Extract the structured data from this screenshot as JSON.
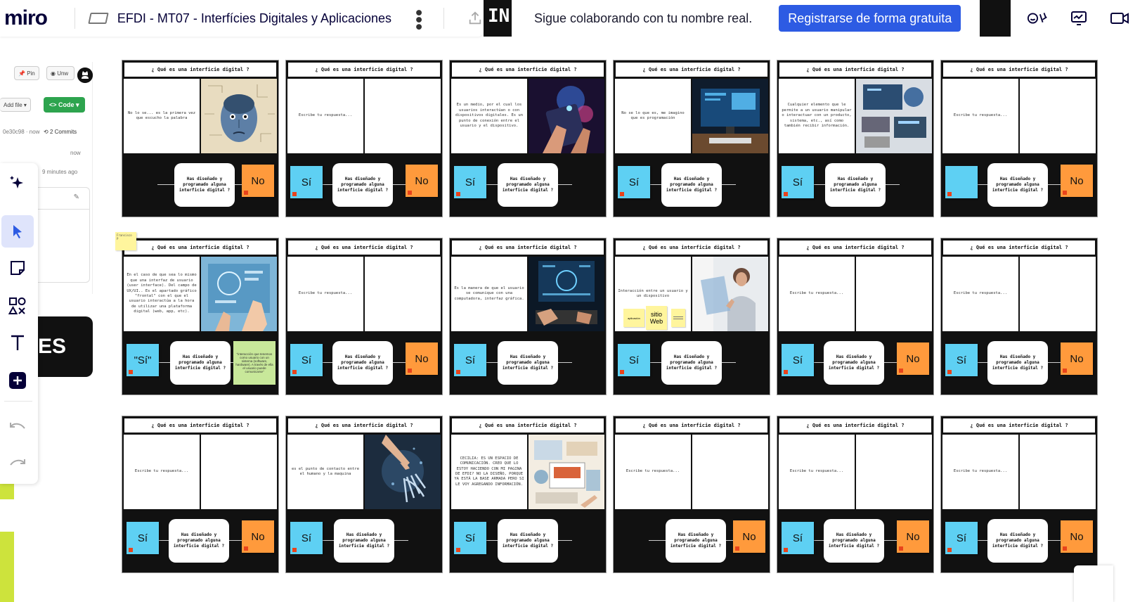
{
  "app": {
    "logo": "miro",
    "board_title": "EFDI - MT07 - Interfícies Digitales y Aplicaciones",
    "top_strip_text": "IN",
    "signup_message": "Sigue colaborando con tu nombre real.",
    "signup_button": "Registrarse de forma gratuita"
  },
  "left_panel": {
    "pin": "Pin",
    "unwatch": "Unw",
    "add_file": "Add file",
    "code": "Code",
    "commit_hash": "0e30c98 · now",
    "commits": "2 Commits",
    "now": "now",
    "minutes_ago": "9 minutes ago",
    "big_label": "ES"
  },
  "sticky_user": "Fransisco P",
  "card_common": {
    "header": "¿ Qué es una interficie digital ?",
    "question": "Has diseñado y programado alguna interficie digital ?",
    "si": "Sí",
    "no": "No"
  },
  "cards": [
    {
      "answer": "No lo se... es la primera vez que escucho la palabra",
      "image": "face",
      "si": false,
      "no": true
    },
    {
      "answer": "Escribe tu respuesta...",
      "image": "",
      "si": true,
      "no": true
    },
    {
      "answer": "Es un medio, por el cual los usuarios interactúan o con dispositivos digitales. Es un punto de conexión entre el usuario y el dispositivo.",
      "image": "hands-tablet",
      "si": true,
      "no": false
    },
    {
      "answer": "No se lo que es, me imagino que es programación",
      "image": "desk-screen",
      "si": true,
      "no": false
    },
    {
      "answer": "Cualquier elemento que le permite a un usuario manipular o interactuar con un producto, sistema, etc., así como también recibir información.",
      "image": "devices",
      "si": true,
      "no": false
    },
    {
      "answer": "Escribe tu respuesta...",
      "image": "",
      "si": true,
      "no": true,
      "si_blank": true
    },
    {
      "answer": "En el caso de que sea lo mismo que una interfaz de usuario (user interface). Del campo de UX/UI.. Es el apartado gráfico \"frontal\" con el que el usuario interactúa a la hora de utilizar una plataforma digital (web, app, etc).",
      "image": "touch-ui",
      "si": true,
      "si_label": "\"Sí\"",
      "no": false,
      "green_note": "\"interacción que tenemos como usuario con un sistema (software, hardware). A través de ella el usuario puede comunicarse\""
    },
    {
      "answer": "Escribe tu respuesta...",
      "image": "",
      "si": true,
      "no": true
    },
    {
      "answer": "Es la manera de que el usuario se comunique con una computadora, interfaz gráfica.",
      "image": "keyboard",
      "si": true,
      "no": false
    },
    {
      "answer": "Interacción entre un usuario y un dispositivo",
      "image": "woman-tablet",
      "si": true,
      "no": false,
      "yellow_notes": [
        "aplicación",
        "sitio Web",
        ""
      ]
    },
    {
      "answer": "Escribe tu respuesta...",
      "image": "",
      "si": true,
      "no": true
    },
    {
      "answer": "Escribe tu respuesta...",
      "image": "",
      "si": true,
      "no": true
    },
    {
      "answer": "Escribe tu respuesta...",
      "image": "",
      "si": true,
      "no": true
    },
    {
      "answer": "es el punto de contacto entre el humano y la maquina",
      "image": "robot-hand",
      "si": true,
      "no": false
    },
    {
      "answer": "CECILIA: ES UN ESPACIO DE COMUNICACIÓN. CREO QUE LO ESTOY HACIENDO CON MI PAGINA DE EFDI? NO LA DISEÑO, PORQUE YA ESTÁ LA BASE ARMADA PERO SI LE VOY AGREGANDO INFORMACIÓN.",
      "image": "collage",
      "si": true,
      "no": false
    },
    {
      "answer": "Escribe tu respuesta...",
      "image": "",
      "si": false,
      "no": true
    },
    {
      "answer": "Escribe tu respuesta...",
      "image": "",
      "si": true,
      "no": true
    },
    {
      "answer": "Escribe tu respuesta...",
      "image": "",
      "si": true,
      "no": true
    }
  ],
  "colors": {
    "accent": "#2d5be3",
    "si": "#5ed0f3",
    "no": "#ff9a3c",
    "code": "#2da44e"
  },
  "icons": [
    "github-icon",
    "share-icon",
    "reactions-icon",
    "present-icon",
    "video-icon",
    "magic-icon",
    "cursor-icon",
    "sticky-note-icon",
    "shapes-icon",
    "text-icon",
    "plus-icon",
    "undo-icon",
    "redo-icon"
  ]
}
